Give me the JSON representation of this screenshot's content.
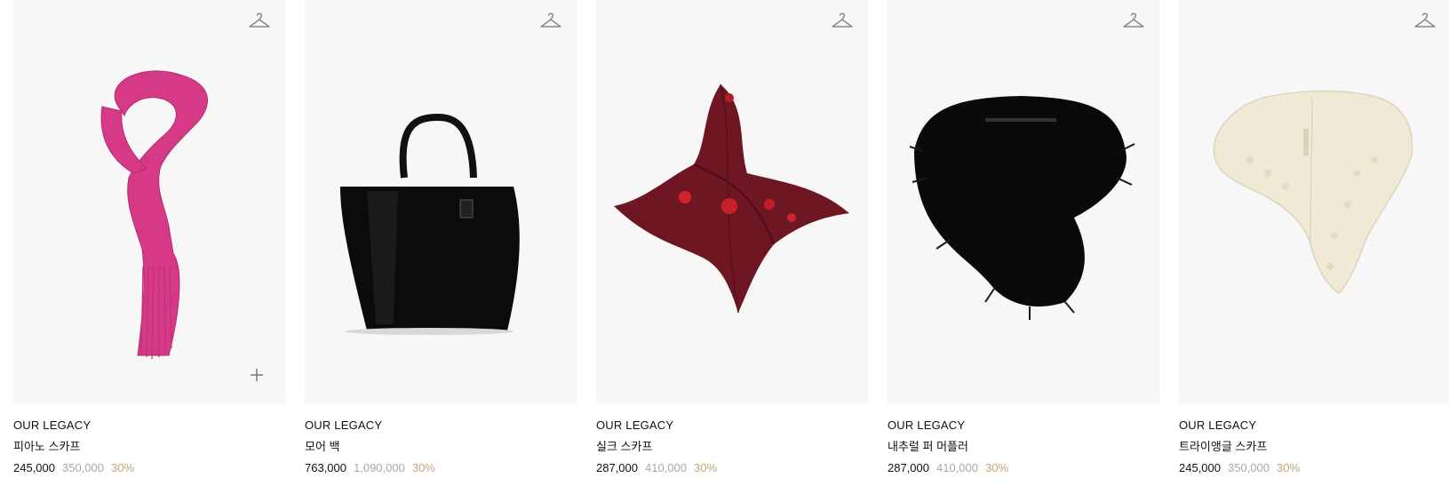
{
  "products": [
    {
      "brand": "OUR LEGACY",
      "name": "피아노 스카프",
      "sale_price": "245,000",
      "original_price": "350,000",
      "discount": "30%",
      "color": "#d63a86"
    },
    {
      "brand": "OUR LEGACY",
      "name": "모어 백",
      "sale_price": "763,000",
      "original_price": "1,090,000",
      "discount": "30%",
      "color": "#0b0b0b"
    },
    {
      "brand": "OUR LEGACY",
      "name": "실크 스카프",
      "sale_price": "287,000",
      "original_price": "410,000",
      "discount": "30%",
      "color": "#6e1622"
    },
    {
      "brand": "OUR LEGACY",
      "name": "내추럴 퍼 머플러",
      "sale_price": "287,000",
      "original_price": "410,000",
      "discount": "30%",
      "color": "#0a0a0a"
    },
    {
      "brand": "OUR LEGACY",
      "name": "트라이앵글 스카프",
      "sale_price": "245,000",
      "original_price": "350,000",
      "discount": "30%",
      "color": "#efe9d6"
    }
  ],
  "icons": {
    "wishlist": "hanger-icon",
    "quick_add": "plus-icon"
  },
  "colors": {
    "discount": "#c8a27a",
    "original_price": "#a8a8a8",
    "image_background": "#f7f7f7"
  }
}
